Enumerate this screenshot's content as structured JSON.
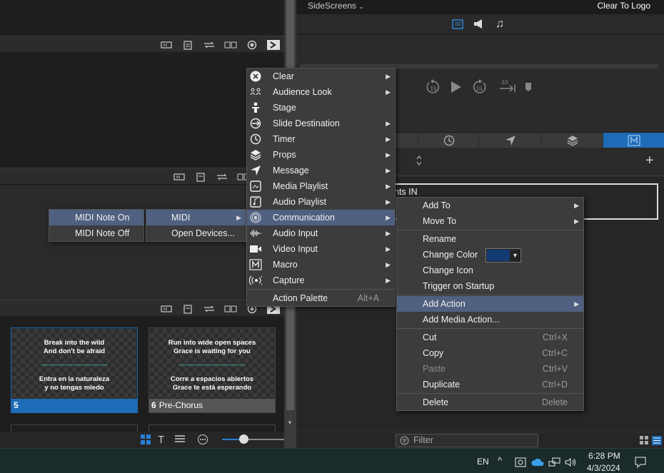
{
  "sidescreens": {
    "title": "SideScreens",
    "clear_to_logo": "Clear To Logo"
  },
  "transport": {
    "skip_back": "15",
    "skip_fwd": "15",
    "minus10": "-10"
  },
  "slides": [
    {
      "number": "5",
      "label": "",
      "top1": "Break into the wild",
      "top2": "And don't be afraid",
      "bot1": "Entra en la naturaleza",
      "bot2": "y no tengas miedo",
      "selected": true
    },
    {
      "number": "6",
      "label": "Pre-Chorus",
      "top1": "Run into wide open spaces",
      "top2": "Grace is waiting for you",
      "bot1": "Corre a espacios abiertos",
      "bot2": "Grace te está esperando",
      "selected": false
    }
  ],
  "partial_text": "nts IN",
  "filter": {
    "placeholder": "Filter"
  },
  "midi_note_menu": {
    "items": [
      "MIDI Note On",
      "MIDI Note Off"
    ]
  },
  "midi_menu": {
    "items": [
      "MIDI",
      "Open Devices..."
    ]
  },
  "action_menu": {
    "items": [
      {
        "label": "Clear",
        "icon": "clear-x-icon"
      },
      {
        "label": "Audience Look",
        "icon": "audience-look-icon"
      },
      {
        "label": "Stage",
        "icon": "stage-icon"
      },
      {
        "label": "Slide Destination",
        "icon": "slide-destination-icon"
      },
      {
        "label": "Timer",
        "icon": "timer-icon"
      },
      {
        "label": "Props",
        "icon": "props-layers-icon"
      },
      {
        "label": "Message",
        "icon": "message-send-icon"
      },
      {
        "label": "Media Playlist",
        "icon": "media-playlist-icon"
      },
      {
        "label": "Audio Playlist",
        "icon": "audio-playlist-icon"
      },
      {
        "label": "Communication",
        "icon": "communication-icon"
      },
      {
        "label": "Audio Input",
        "icon": "audio-input-waveform-icon"
      },
      {
        "label": "Video Input",
        "icon": "video-camera-icon"
      },
      {
        "label": "Macro",
        "icon": "macro-m-icon"
      },
      {
        "label": "Capture",
        "icon": "capture-broadcast-icon"
      }
    ],
    "palette": {
      "label": "Action Palette",
      "shortcut": "Alt+A"
    }
  },
  "context_menu": {
    "add_to": "Add To",
    "move_to": "Move To",
    "rename": "Rename",
    "change_color": "Change Color",
    "change_color_value": "#123b72",
    "change_icon": "Change Icon",
    "trigger_on_startup": "Trigger on Startup",
    "add_action": "Add Action",
    "add_media_action": "Add Media Action...",
    "cut": "Cut",
    "cut_sc": "Ctrl+X",
    "copy": "Copy",
    "copy_sc": "Ctrl+C",
    "paste": "Paste",
    "paste_sc": "Ctrl+V",
    "duplicate": "Duplicate",
    "duplicate_sc": "Ctrl+D",
    "delete": "Delete",
    "delete_sc": "Delete"
  },
  "taskbar": {
    "lang": "EN",
    "time": "6:28 PM",
    "date": "4/3/2024"
  },
  "colors": {
    "accent_blue": "#1e6bb8",
    "menu_highlight": "#4f6080"
  }
}
